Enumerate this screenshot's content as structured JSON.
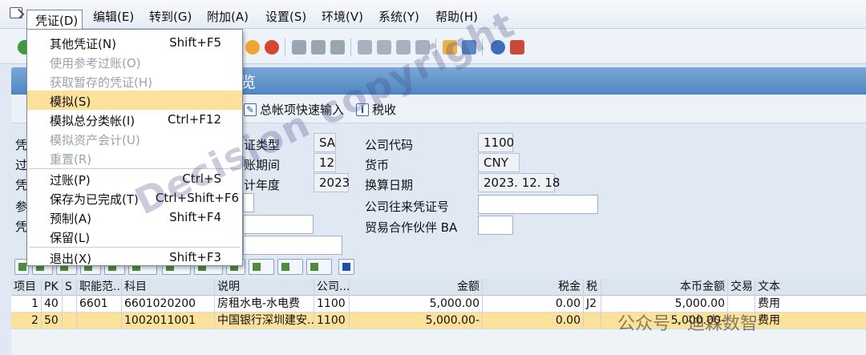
{
  "menubar": {
    "items": [
      "凭证(D)",
      "编辑(E)",
      "转到(G)",
      "附加(A)",
      "设置(S)",
      "环境(V)",
      "系统(Y)",
      "帮助(H)"
    ]
  },
  "title": {
    "suffix": "览"
  },
  "app_toolbar": {
    "gl_fast_entry": "总帐项快速输入",
    "tax": "税收"
  },
  "dropdown": {
    "items": [
      {
        "label": "其他凭证(N)",
        "shortcut": "Shift+F5"
      },
      {
        "label": "使用参考过账(O)",
        "shortcut": ""
      },
      {
        "label": "获取暂存的凭证(H)",
        "shortcut": ""
      },
      {
        "label": "模拟(S)",
        "shortcut": ""
      },
      {
        "label": "模拟总分类帐(I)",
        "shortcut": "Ctrl+F12"
      },
      {
        "label": "模拟资产会计(U)",
        "shortcut": ""
      },
      {
        "label": "重置(R)",
        "shortcut": ""
      },
      {
        "label": "过账(P)",
        "shortcut": "Ctrl+S"
      },
      {
        "label": "保存为已完成(T)",
        "shortcut": "Ctrl+Shift+F6"
      },
      {
        "label": "预制(A)",
        "shortcut": "Shift+F4"
      },
      {
        "label": "保留(L)",
        "shortcut": ""
      },
      {
        "label": "退出(X)",
        "shortcut": "Shift+F3"
      }
    ]
  },
  "form": {
    "left_labels": [
      "凭",
      "过",
      "凭",
      "参",
      "凭"
    ],
    "doc_type_label": "证类型",
    "doc_type_value": "SA",
    "period_label": "账期间",
    "period_value": "12",
    "fiscal_year_label": "计年度",
    "fiscal_year_value": "2023",
    "company_code_label": "公司代码",
    "company_code_value": "1100",
    "currency_label": "货币",
    "currency_value": "CNY",
    "translation_date_label": "换算日期",
    "translation_date_value": "2023. 12. 18",
    "intercompany_label": "公司往来凭证号",
    "intercompany_value": "",
    "partner_label": "贸易合作伙伴 BA",
    "partner_value": ""
  },
  "grid": {
    "headers": [
      "项目",
      "PK",
      "S",
      "职能范...",
      "科目",
      "说明",
      "公司...",
      "金额",
      "税金",
      "税",
      "本币金额",
      "交易",
      "文本"
    ],
    "rows": [
      [
        "1",
        "40",
        "",
        "6601",
        "6601020200",
        "房租水电-水电费",
        "1100",
        "5,000.00",
        "0.00",
        "J2",
        "5,000.00",
        "",
        "费用"
      ],
      [
        "2",
        "50",
        "",
        "",
        "1002011001",
        "中国银行深圳建安...",
        "1100",
        "5,000.00-",
        "0.00",
        "",
        "5,000.00-",
        "",
        "费用"
      ]
    ]
  },
  "watermark": {
    "text": "Decision copyright"
  },
  "badge": {
    "text": "公众号 · 迪森数智"
  }
}
